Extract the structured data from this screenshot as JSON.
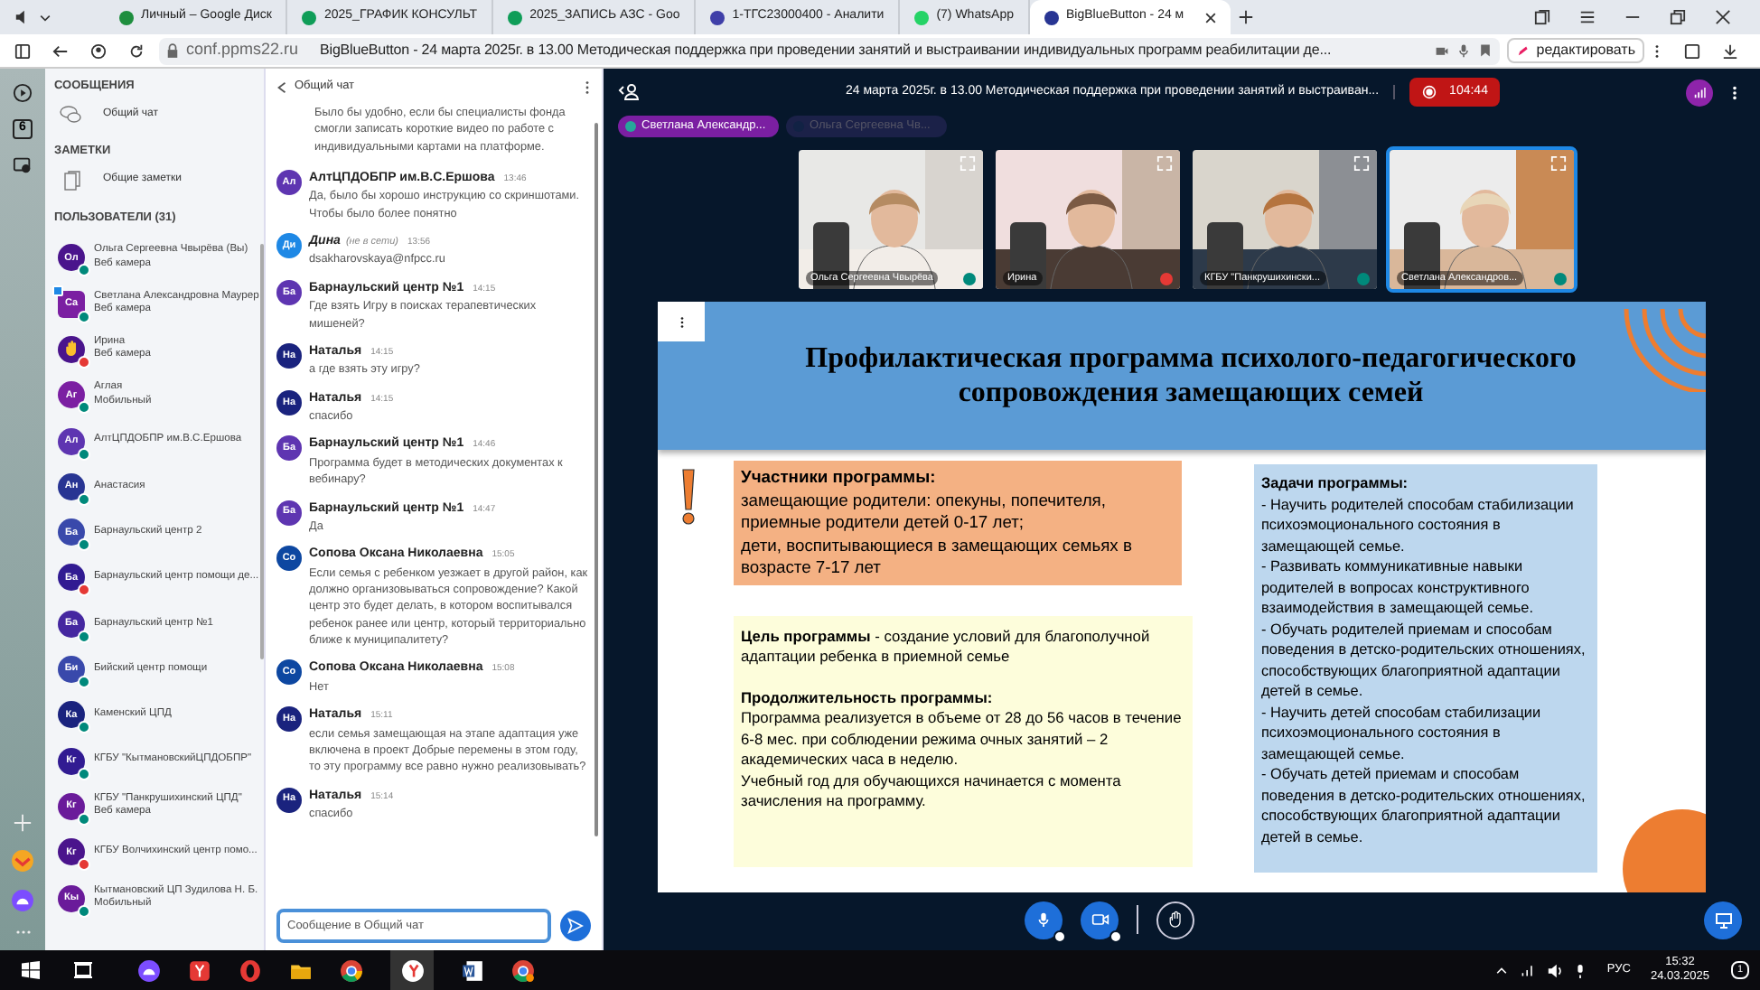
{
  "browser": {
    "tabs": [
      {
        "label": "Личный – Google Диск",
        "selected": false,
        "color": "#1e8e3e"
      },
      {
        "label": "2025_ГРАФИК КОНСУЛЬТ",
        "selected": false,
        "color": "#0f9d58"
      },
      {
        "label": "2025_ЗАПИСЬ АЗС - Goo",
        "selected": false,
        "color": "#0f9d58"
      },
      {
        "label": "1-ТГС23000400 - Аналити",
        "selected": false,
        "color": "#3f3fa8"
      },
      {
        "label": "(7) WhatsApp",
        "selected": false,
        "color": "#25d366"
      },
      {
        "label": "BigBlueButton - 24 м",
        "selected": true,
        "color": "#283593"
      }
    ],
    "address": "conf.ppms22.ru",
    "page_title": "BigBlueButton - 24 марта 2025г. в 13.00 Методическая поддержка при проведении занятий и выстраивании индивидуальных программ реабилитации де...",
    "edit_button": "редактировать",
    "side_badge": "6"
  },
  "sidebar": {
    "messages_heading": "СООБЩЕНИЯ",
    "chat_link": "Общий чат",
    "notes_heading": "ЗАМЕТКИ",
    "notes_link": "Общие заметки",
    "users_heading": "ПОЛЬЗОВАТЕЛИ (31)",
    "users": [
      {
        "initials": "Ол",
        "name": "Ольга Сергеевна Чвырёва (Вы)",
        "device": "Веб камера",
        "muted": false,
        "presenter": false,
        "hand_raised": false,
        "color": "#4a148c"
      },
      {
        "initials": "Са",
        "name": "Светлана Александровна Маурер",
        "device": "Веб камера",
        "muted": false,
        "presenter": true,
        "hand_raised": false,
        "color": "#7b1fa2"
      },
      {
        "name": "Ирина",
        "device": "Веб камера",
        "muted": true,
        "presenter": false,
        "hand_raised": true,
        "color": "#4a148c"
      },
      {
        "initials": "Аг",
        "name": "Аглая",
        "device": "Мобильный",
        "muted": false,
        "presenter": false,
        "hand_raised": false,
        "color": "#7b1fa2"
      },
      {
        "initials": "Ал",
        "name": "АлтЦПДОБПР им.В.С.Ершова",
        "muted": false,
        "presenter": false,
        "hand_raised": false,
        "color": "#5e35b1"
      },
      {
        "initials": "Ан",
        "name": "Анастасия",
        "muted": false,
        "presenter": false,
        "hand_raised": false,
        "color": "#283593"
      },
      {
        "initials": "Ба",
        "name": "Барнаульский центр 2",
        "muted": false,
        "presenter": false,
        "hand_raised": false,
        "color": "#3949ab"
      },
      {
        "initials": "Ба",
        "name": "Барнаульский центр помощи де...",
        "muted": true,
        "presenter": false,
        "hand_raised": false,
        "color": "#311b92"
      },
      {
        "initials": "Ба",
        "name": "Барнаульский центр №1",
        "muted": false,
        "presenter": false,
        "hand_raised": false,
        "color": "#4527a0"
      },
      {
        "initials": "Би",
        "name": "Бийский центр помощи",
        "muted": false,
        "presenter": false,
        "hand_raised": false,
        "color": "#3949ab"
      },
      {
        "initials": "Ка",
        "name": "Каменский ЦПД",
        "muted": false,
        "presenter": false,
        "hand_raised": false,
        "color": "#1a237e"
      },
      {
        "initials": "Кг",
        "name": "КГБУ \"КытмановскийЦПДОБПР\"",
        "muted": false,
        "presenter": false,
        "hand_raised": false,
        "color": "#311b92"
      },
      {
        "initials": "Кг",
        "name": "КГБУ \"Панкрушихинский ЦПД\"",
        "device": "Веб камера",
        "muted": false,
        "presenter": false,
        "hand_raised": false,
        "color": "#6a1b9a"
      },
      {
        "initials": "Кг",
        "name": "КГБУ Волчихинский центр помо...",
        "muted": true,
        "presenter": false,
        "hand_raised": false,
        "color": "#4a148c"
      },
      {
        "initials": "Кы",
        "name": "Кытмановский ЦП Зудилова Н. Б.",
        "device": "Мобильный",
        "muted": false,
        "presenter": false,
        "hand_raised": false,
        "color": "#6a1b9a"
      }
    ]
  },
  "chat": {
    "title": "Общий чат",
    "placeholder": "Сообщение в Общий чат",
    "messages": [
      {
        "kind": "continued",
        "text": "Было бы удобно, если бы специалисты фонда смогли записать короткие видео по работе с индивидуальными картами на платформе."
      },
      {
        "kind": "message",
        "initials": "Ал",
        "name": "АлтЦПДОБПР им.В.С.Ершова",
        "time": "13:46",
        "text": "Да, было бы хорошо инструкцию со скриншотами. Чтобы было более понятно",
        "color": "#5e35b1"
      },
      {
        "kind": "message",
        "initials": "Ди",
        "name": "Дина",
        "status_note": "(не в сети)",
        "time": "13:56",
        "text": "dsakharovskaya@nfpcc.ru",
        "color": "#1e88e5"
      },
      {
        "kind": "message",
        "initials": "Ба",
        "name": "Барнаульский центр №1",
        "time": "14:15",
        "text": "Где взять Игру в поисках терапевтических мишеней?",
        "color": "#5e35b1"
      },
      {
        "kind": "message",
        "initials": "На",
        "name": "Наталья",
        "time": "14:15",
        "text": "а где взять эту игру?",
        "color": "#1a237e"
      },
      {
        "kind": "message",
        "initials": "На",
        "name": "Наталья",
        "time": "14:15",
        "text": "спасибо",
        "color": "#1a237e"
      },
      {
        "kind": "message",
        "initials": "Ба",
        "name": "Барнаульский центр №1",
        "time": "14:46",
        "text": "Программа будет в методических документах к вебинару?",
        "color": "#5e35b1"
      },
      {
        "kind": "message",
        "initials": "Ба",
        "name": "Барнаульский центр №1",
        "time": "14:47",
        "text": "Да",
        "color": "#5e35b1"
      },
      {
        "kind": "message",
        "initials": "Со",
        "name": "Сопова Оксана Николаевна",
        "time": "15:05",
        "text": "Если семья с ребенком уезжает в другой район, как должно организовываться сопровождение? Какой центр это будет делать, в котором воспитывался ребенок ранее или центр, который территориально ближе к муниципалитету?",
        "color": "#0d47a1"
      },
      {
        "kind": "message",
        "initials": "Со",
        "name": "Сопова Оксана Николаевна",
        "time": "15:08",
        "text": "Нет",
        "color": "#0d47a1"
      },
      {
        "kind": "message",
        "initials": "На",
        "name": "Наталья",
        "time": "15:11",
        "text": "если семья замещающая на этапе адаптация уже включена в проект Добрые перемены в этом году, то эту программу все равно нужно реализовывать?",
        "color": "#1a237e"
      },
      {
        "kind": "message",
        "initials": "На",
        "name": "Наталья",
        "time": "15:14",
        "text": "спасибо",
        "color": "#1a237e"
      }
    ]
  },
  "meeting": {
    "title": "24 марта 2025г. в 13.00 Методическая поддержка при проведении занятий и выстраиван...",
    "recording_time": "104:44",
    "talkers": [
      {
        "name": "Светлана Александр...",
        "active": true
      },
      {
        "name": "Ольга Сергеевна Чв...",
        "active": false
      }
    ],
    "videos": [
      {
        "name": "Ольга Сергеевна Чвырёва",
        "muted": false,
        "selected": false
      },
      {
        "name": "Ирина",
        "muted": true,
        "selected": false
      },
      {
        "name": "КГБУ \"Панкрушихински...",
        "muted": false,
        "selected": false
      },
      {
        "name": "Светлана Александров...",
        "muted": false,
        "selected": true
      }
    ]
  },
  "slide": {
    "title": "Профилактическая программа психолого-педагогического сопровождения замещающих семей",
    "participants": {
      "heading": "Участники программы:",
      "lines": [
        "замещающие родители: опекуны, попечителя, приемные родители детей 0-17 лет;",
        "дети, воспитывающиеся в замещающих семьях в возрасте 7-17 лет"
      ]
    },
    "goal": "**Цель программы** - создание условий для благополучной адаптации ребенка в приемной семье",
    "duration": {
      "heading": "Продолжительность программы:",
      "lines": [
        "Программа реализуется в объеме от 28 до 56 часов в течение 6-8 мес. при соблюдении режима очных занятий – 2 академических часа в неделю.",
        "Учебный год для обучающихся начинается с момента зачисления на программу."
      ]
    },
    "tasks": {
      "heading": "Задачи программы:",
      "lines": [
        "- Научить родителей способам стабилизации психоэмоционального состояния в замещающей семье.",
        "- Развивать коммуникативные навыки родителей в вопросах конструктивного взаимодействия в замещающей семье.",
        "- Обучать родителей приемам и способам поведения в детско-родительских отношениях, способствующих благоприятной адаптации детей в семье.",
        "- Научить детей способам стабилизации психоэмоционального состояния в замещающей семье.",
        "- Обучать детей приемам и способам поведения в детско-родительских отношениях, способствующих благоприятной адаптации детей в семье."
      ]
    }
  },
  "taskbar": {
    "language": "РУС",
    "time": "15:32",
    "date": "24.03.2025",
    "notifications": "1"
  }
}
